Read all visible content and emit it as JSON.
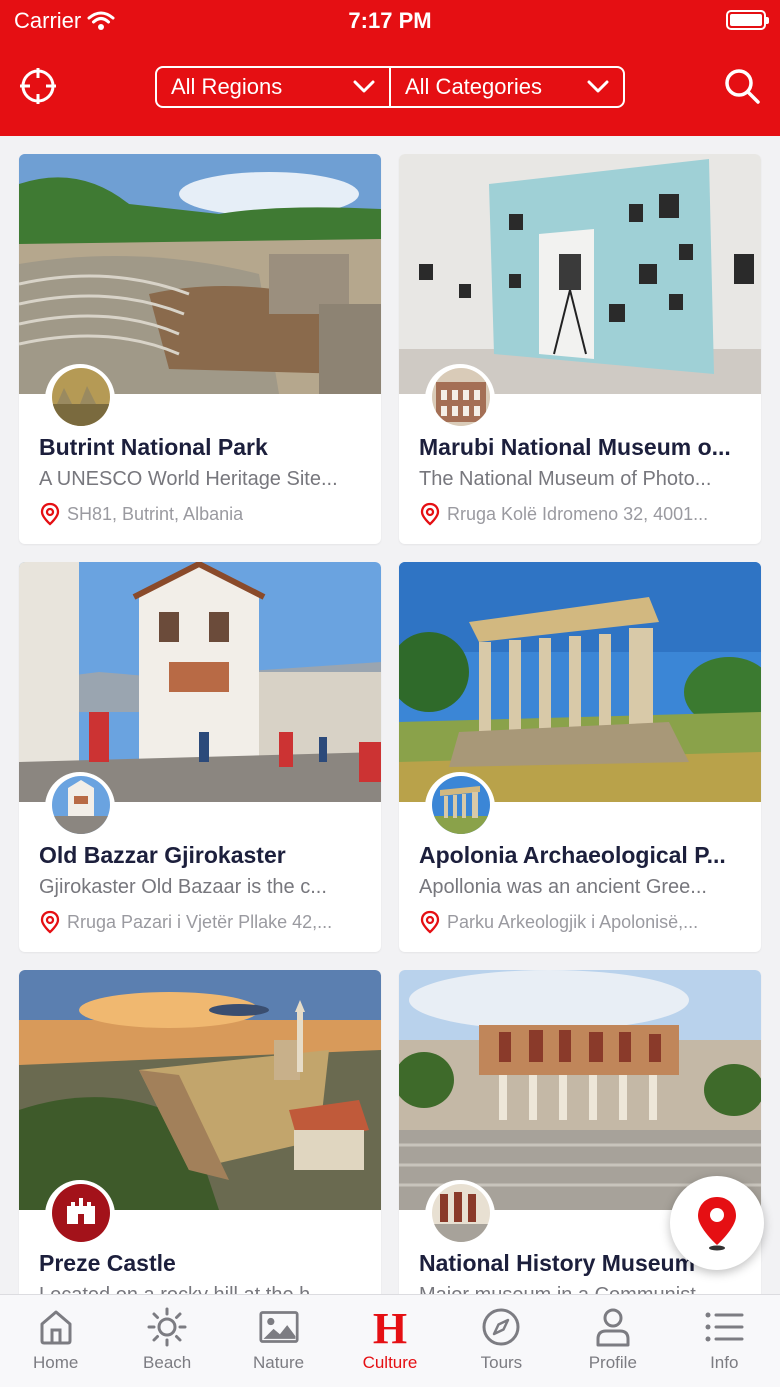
{
  "status_bar": {
    "carrier": "Carrier",
    "time": "7:17 PM"
  },
  "toolbar": {
    "region_filter": "All Regions",
    "category_filter": "All Categories"
  },
  "colors": {
    "brand": "#e50f13",
    "title": "#1c1f3c",
    "muted": "#77777d"
  },
  "places": [
    {
      "name": "Butrint National Park",
      "description": "A UNESCO World Heritage Site...",
      "address": "SH81, Butrint, Albania"
    },
    {
      "name": "Marubi National Museum o...",
      "description": "The National Museum of Photo...",
      "address": "Rruga Kolë Idromeno 32, 4001..."
    },
    {
      "name": "Old Bazzar Gjirokaster",
      "description": "Gjirokaster Old Bazaar is the c...",
      "address": "Rruga Pazari i Vjetër Pllake 42,..."
    },
    {
      "name": "Apolonia Archaeological P...",
      "description": "Apollonia was an ancient Gree...",
      "address": "Parku Arkeologjik i Apolonisë,..."
    },
    {
      "name": "Preze Castle",
      "description": "Located on a rocky hill at the h...",
      "address": ""
    },
    {
      "name": "National History Museum",
      "description": "Major museum in a Communist...",
      "address": ""
    }
  ],
  "tabs": [
    {
      "label": "Home",
      "icon": "home-icon"
    },
    {
      "label": "Beach",
      "icon": "sun-icon"
    },
    {
      "label": "Nature",
      "icon": "image-icon"
    },
    {
      "label": "Culture",
      "icon": "culture-h-icon"
    },
    {
      "label": "Tours",
      "icon": "compass-icon"
    },
    {
      "label": "Profile",
      "icon": "person-icon"
    },
    {
      "label": "Info",
      "icon": "list-icon"
    }
  ]
}
